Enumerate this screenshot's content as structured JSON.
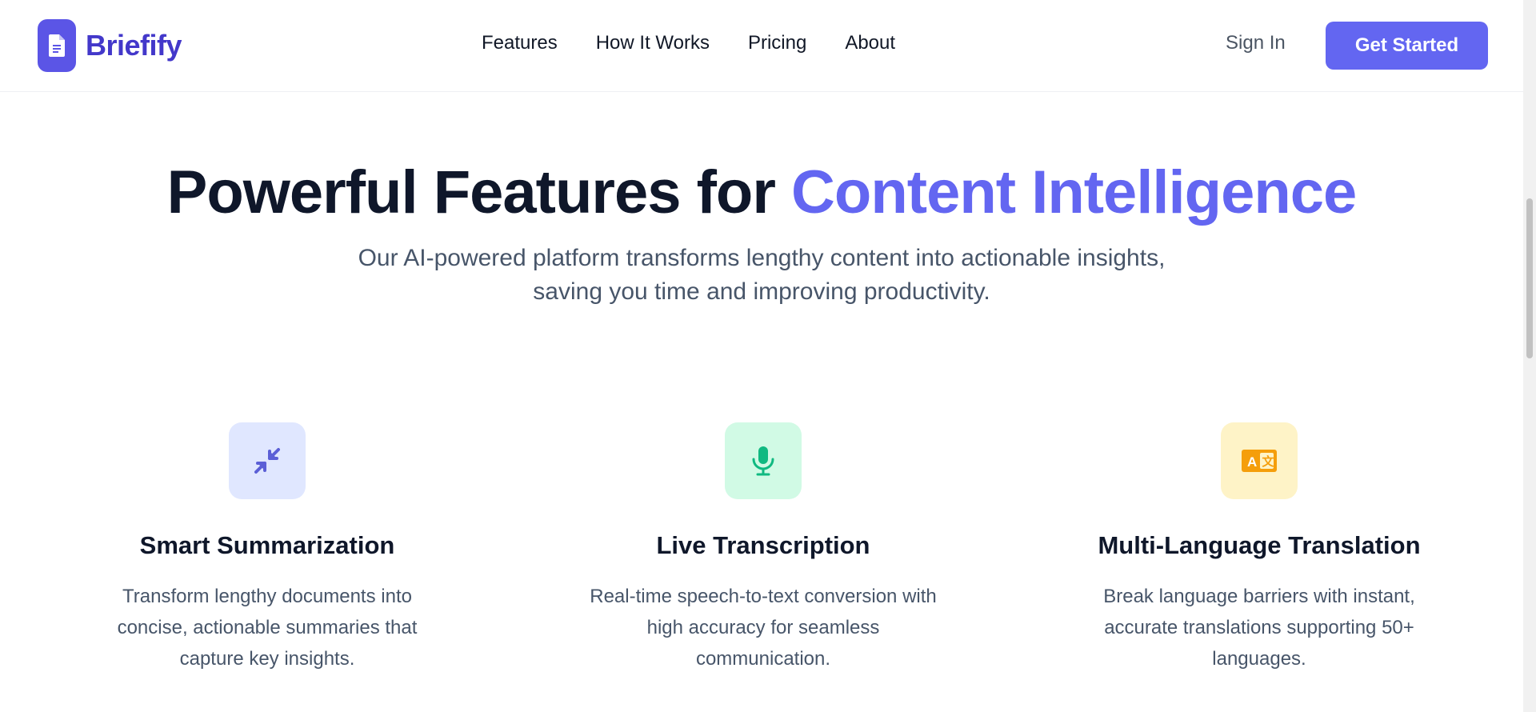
{
  "header": {
    "brand_name": "Briefify",
    "brand_icon": "document-icon",
    "nav": [
      "Features",
      "How It Works",
      "Pricing",
      "About"
    ],
    "sign_in_label": "Sign In",
    "cta_label": "Get Started"
  },
  "hero": {
    "title_main": "Powerful Features for",
    "title_accent": "Content Intelligence",
    "subtitle_line1": "Our AI-powered platform transforms lengthy content into actionable insights,",
    "subtitle_line2": "saving you time and improving productivity."
  },
  "features": [
    {
      "icon": "compress-arrows-icon",
      "title": "Smart Summarization",
      "description": "Transform lengthy documents into concise, actionable summaries that capture key insights."
    },
    {
      "icon": "microphone-icon",
      "title": "Live Transcription",
      "description": "Real-time speech-to-text conversion with high accuracy for seamless communication."
    },
    {
      "icon": "translate-icon",
      "title": "Multi-Language Translation",
      "description": "Break language barriers with instant, accurate translations supporting 50+ languages."
    }
  ],
  "colors": {
    "primary": "#6366f1",
    "brand": "#4338ca",
    "heading": "#0f172a",
    "body_text": "#475569",
    "summarization_bg": "#e0e7ff",
    "summarization_icon": "#5b5fd6",
    "transcription_bg": "#d1fae5",
    "transcription_icon": "#10b981",
    "translation_bg": "#fef3c7",
    "translation_icon": "#f59e0b"
  }
}
